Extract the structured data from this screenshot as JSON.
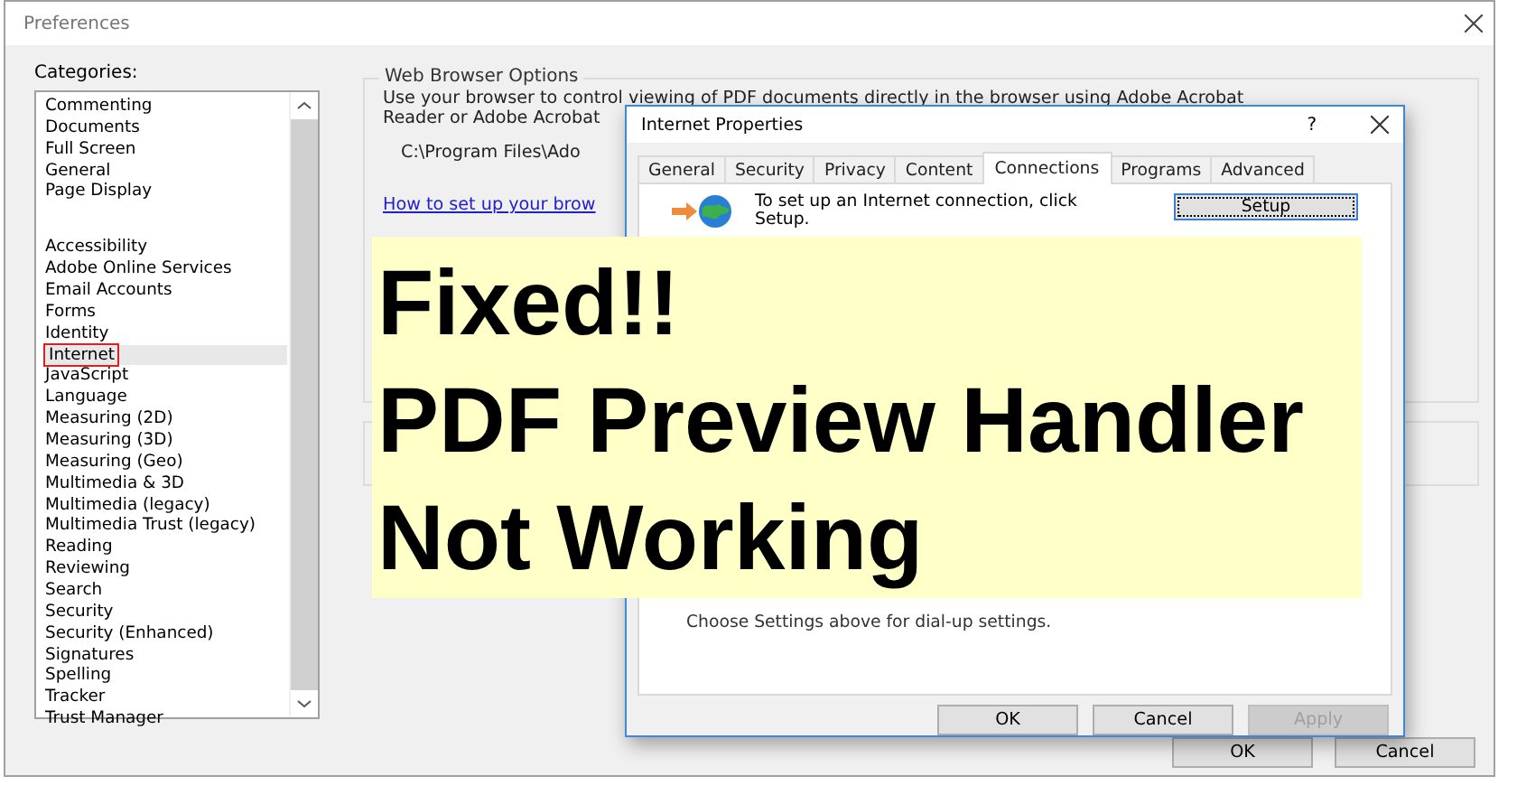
{
  "window": {
    "title": "Preferences"
  },
  "categories": {
    "label": "Categories:",
    "groups": [
      [
        {
          "label": "Commenting",
          "selected": false
        },
        {
          "label": "Documents",
          "selected": false
        },
        {
          "label": "Full Screen",
          "selected": false
        },
        {
          "label": "General",
          "selected": false
        },
        {
          "label": "Page Display",
          "selected": false
        }
      ],
      [
        {
          "label": "Accessibility",
          "selected": false
        },
        {
          "label": "Adobe Online Services",
          "selected": false
        },
        {
          "label": "Email Accounts",
          "selected": false
        },
        {
          "label": "Forms",
          "selected": false
        },
        {
          "label": "Identity",
          "selected": false
        },
        {
          "label": "Internet",
          "selected": true
        },
        {
          "label": "JavaScript",
          "selected": false
        },
        {
          "label": "Language",
          "selected": false
        },
        {
          "label": "Measuring (2D)",
          "selected": false
        },
        {
          "label": "Measuring (3D)",
          "selected": false
        },
        {
          "label": "Measuring (Geo)",
          "selected": false
        },
        {
          "label": "Multimedia & 3D",
          "selected": false
        },
        {
          "label": "Multimedia (legacy)",
          "selected": false
        },
        {
          "label": "Multimedia Trust (legacy)",
          "selected": false
        },
        {
          "label": "Reading",
          "selected": false
        },
        {
          "label": "Reviewing",
          "selected": false
        },
        {
          "label": "Search",
          "selected": false
        },
        {
          "label": "Security",
          "selected": false
        },
        {
          "label": "Security (Enhanced)",
          "selected": false
        },
        {
          "label": "Signatures",
          "selected": false
        },
        {
          "label": "Spelling",
          "selected": false
        },
        {
          "label": "Tracker",
          "selected": false
        },
        {
          "label": "Trust Manager",
          "selected": false
        }
      ]
    ]
  },
  "web_browser_options": {
    "title": "Web Browser Options",
    "description": [
      "Use your browser to control viewing of PDF documents directly in the browser using Adobe Acrobat",
      "Reader or Adobe Acrobat"
    ],
    "path": "C:\\Program Files\\Ado",
    "link": "How to set up your brow"
  },
  "buttons": [
    "OK",
    "Cancel"
  ],
  "dialog": {
    "title": "Internet Properties",
    "help": "?",
    "tabs": [
      {
        "label": "General",
        "selected": false
      },
      {
        "label": "Security",
        "selected": false
      },
      {
        "label": "Privacy",
        "selected": false
      },
      {
        "label": "Content",
        "selected": false
      },
      {
        "label": "Connections",
        "selected": true
      },
      {
        "label": "Programs",
        "selected": false
      },
      {
        "label": "Advanced",
        "selected": false
      }
    ],
    "setup_text": "To set up an Internet connection, click Setup.",
    "setup_button": "Setup",
    "dialup_text": "Choose Settings above for dial-up settings.",
    "buttons": [
      {
        "label": "OK",
        "disabled": false
      },
      {
        "label": "Cancel",
        "disabled": false
      },
      {
        "label": "Apply",
        "disabled": true
      }
    ]
  },
  "banner": {
    "lines": [
      "Fixed!!",
      "PDF Preview Handler",
      "Not Working"
    ]
  }
}
